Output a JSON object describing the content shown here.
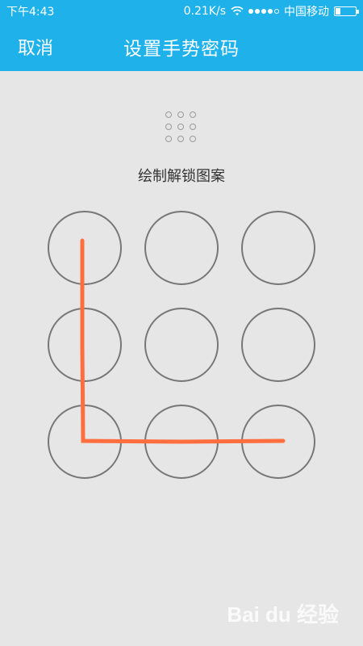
{
  "status": {
    "time": "下午4:43",
    "speed": "0.21K/s",
    "carrier": "中国移动",
    "battery_level": 0.25
  },
  "header": {
    "cancel_label": "取消",
    "title": "设置手势密码"
  },
  "instruction": "绘制解锁图案",
  "pattern": {
    "path": [
      0,
      3,
      6,
      7,
      8
    ],
    "line_color": "#ff6e3f",
    "circle_color": "#777777"
  },
  "watermark": "Bai du 经验",
  "colors": {
    "accent": "#1fb2ea",
    "background": "#e6e6e6"
  }
}
